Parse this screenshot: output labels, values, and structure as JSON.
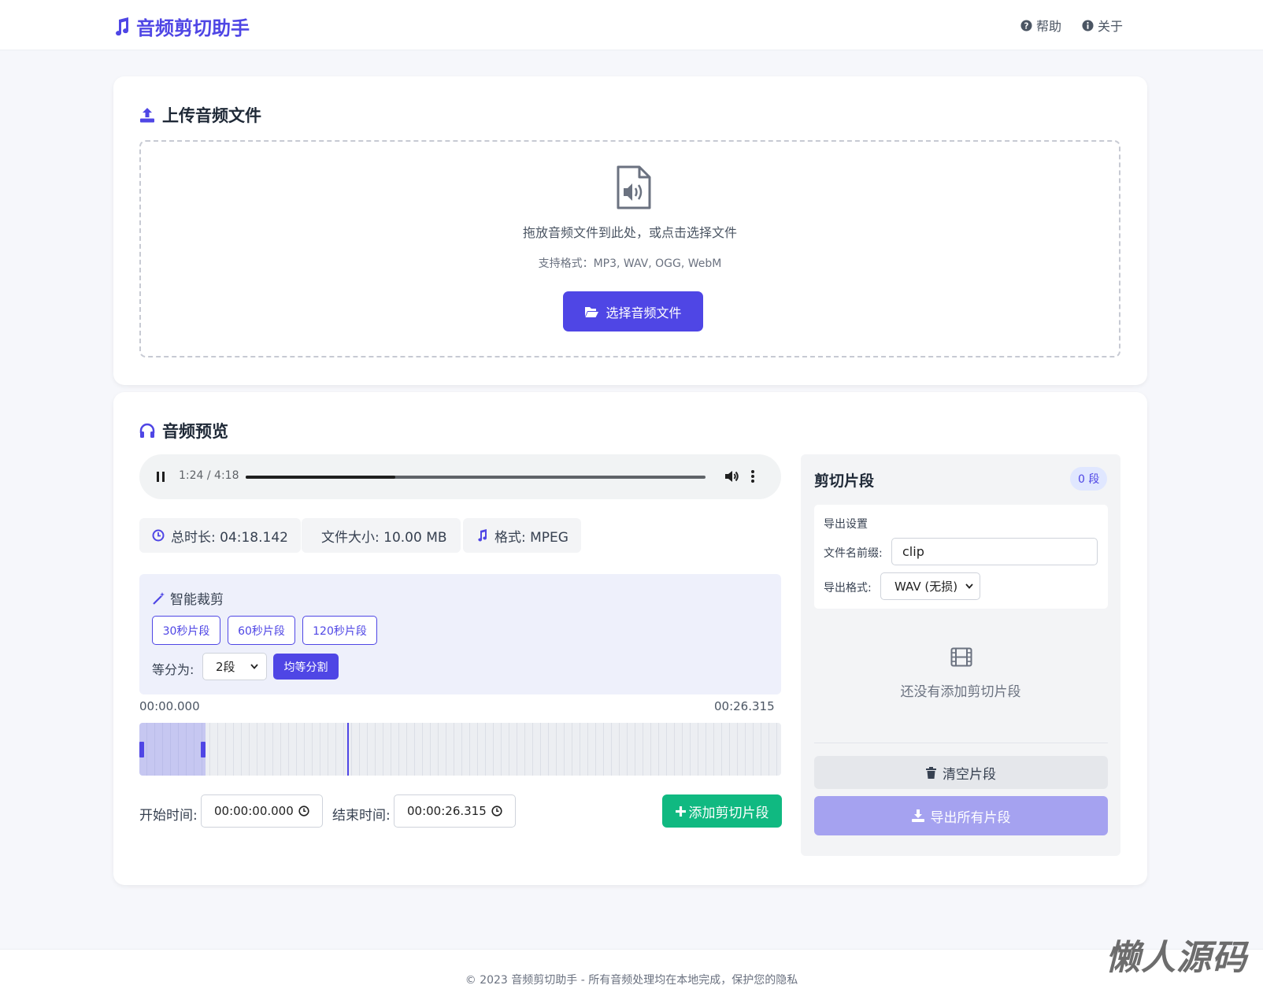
{
  "header": {
    "title": "音频剪切助手",
    "nav": [
      {
        "label": "帮助",
        "icon": "question-circle-icon"
      },
      {
        "label": "关于",
        "icon": "info-circle-icon"
      }
    ]
  },
  "upload": {
    "title": "上传音频文件",
    "drop_text": "拖放音频文件到此处，或点击选择文件",
    "formats_text": "支持格式：MP3, WAV, OGG, WebM",
    "choose_button": "选择音频文件"
  },
  "preview": {
    "title": "音频预览",
    "player": {
      "time": "1:24 / 4:18",
      "progress": 0.326
    },
    "info": {
      "duration": "总时长: 04:18.142",
      "size": "文件大小: 10.00 MB",
      "format": "格式: MPEG"
    },
    "smart_cut": {
      "title": "智能裁剪",
      "presets": [
        "30秒片段",
        "60秒片段",
        "120秒片段"
      ],
      "equal_label": "等分为:",
      "equal_value": "2段",
      "equal_button": "均等分割"
    },
    "timeline": {
      "start_label": "00:00.000",
      "end_label": "00:26.315",
      "selection_fraction": 0.103,
      "playhead_fraction": 0.324
    },
    "start_time": {
      "label": "开始时间:",
      "value": "00:00:00.000"
    },
    "end_time": {
      "label": "结束时间:",
      "value": "00:00:26.315"
    },
    "add_button": "添加剪切片段"
  },
  "segments": {
    "title": "剪切片段",
    "count": "0 段",
    "export": {
      "title": "导出设置",
      "prefix_label": "文件名前缀:",
      "prefix_value": "clip",
      "format_label": "导出格式:",
      "format_value": "WAV (无损)"
    },
    "empty_text": "还没有添加剪切片段",
    "clear_button": "清空片段",
    "export_button": "导出所有片段"
  },
  "footer": {
    "text": "© 2023 音频剪切助手 - 所有音频处理均在本地完成，保护您的隐私",
    "watermark": "懒人源码"
  },
  "colors": {
    "accent": "#4f46e5",
    "success": "#10b981",
    "export_disabled": "#a5a2f0"
  }
}
